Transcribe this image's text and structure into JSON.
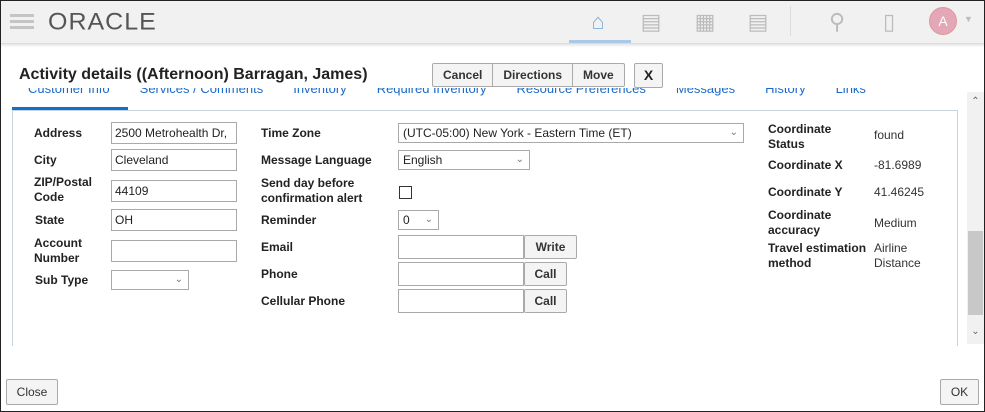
{
  "header": {
    "logo": "ORACLE",
    "avatar_initial": "A",
    "nav_icons": [
      "home-icon",
      "report-icon",
      "calendar-icon",
      "chart-icon",
      "search-icon",
      "chat-icon"
    ]
  },
  "dialog": {
    "title": "Activity details ((Afternoon) Barragan, James)",
    "buttons": {
      "cancel": "Cancel",
      "directions": "Directions",
      "move": "Move",
      "close_x": "X"
    }
  },
  "tabs": [
    "Customer Info",
    "Services / Comments",
    "Inventory",
    "Required Inventory",
    "Resource Preferences",
    "Messages",
    "History",
    "Links"
  ],
  "left": {
    "address_label": "Address",
    "address": "2500 Metrohealth Dr,",
    "city_label": "City",
    "city": "Cleveland",
    "zip_label": "ZIP/Postal Code",
    "zip": "44109",
    "state_label": "State",
    "state": "OH",
    "account_label": "Account Number",
    "account": "",
    "subtype_label": "Sub Type",
    "subtype": ""
  },
  "middle": {
    "timezone_label": "Time Zone",
    "timezone": "(UTC-05:00) New York - Eastern Time (ET)",
    "language_label": "Message Language",
    "language": "English",
    "sendday_label": "Send day before confirmation alert",
    "reminder_label": "Reminder",
    "reminder": "0",
    "email_label": "Email",
    "email": "",
    "write": "Write",
    "phone_label": "Phone",
    "phone": "",
    "call": "Call",
    "cell_label": "Cellular Phone",
    "cell": ""
  },
  "right": {
    "status_label": "Coordinate Status",
    "status": "found",
    "x_label": "Coordinate X",
    "x": "-81.6989",
    "y_label": "Coordinate Y",
    "y": "41.46245",
    "acc_label": "Coordinate accuracy",
    "acc": "Medium",
    "travel_label": "Travel estimation method",
    "travel": "Airline Distance"
  },
  "footer": {
    "close": "Close",
    "ok": "OK"
  }
}
